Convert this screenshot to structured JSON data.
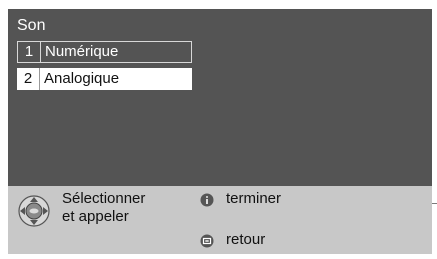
{
  "menu": {
    "title": "Son",
    "items": [
      {
        "number": "1",
        "label": "Numérique",
        "state": "outlined"
      },
      {
        "number": "2",
        "label": "Analogique",
        "state": "selected"
      }
    ]
  },
  "footer": {
    "select_line1": "Sélectionner",
    "select_line2": "et appeler",
    "finish_label": "terminer",
    "back_label": "retour",
    "icons": [
      "navigation-ok-icon",
      "info-icon",
      "back-icon"
    ]
  },
  "colors": {
    "screen_bg": "#545454",
    "footer_bg": "#c8c8c8",
    "selected_bg": "#ffffff",
    "text_light": "#ffffff",
    "text_dark": "#111111"
  }
}
